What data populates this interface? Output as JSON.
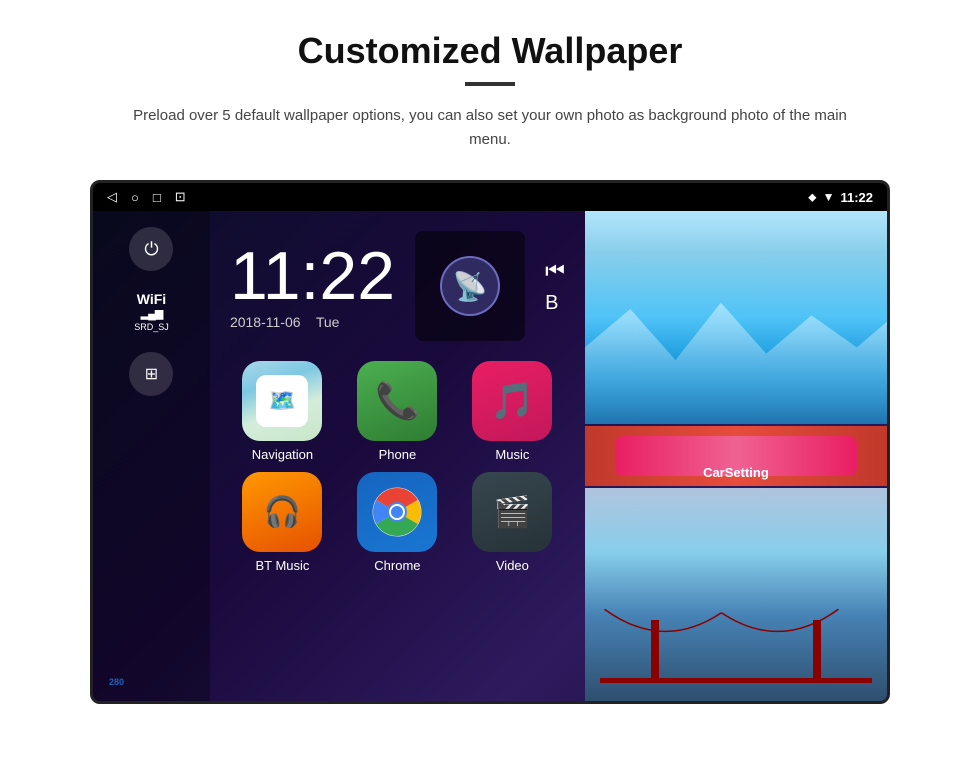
{
  "header": {
    "title": "Customized Wallpaper",
    "divider": true,
    "subtitle": "Preload over 5 default wallpaper options, you can also set your own photo as background photo of the main menu."
  },
  "device": {
    "status_bar": {
      "back_icon": "◁",
      "home_icon": "○",
      "recents_icon": "□",
      "screenshot_icon": "⊡",
      "location_icon": "⬥",
      "signal_icon": "▼",
      "time": "11:22"
    },
    "clock": {
      "time": "11:22",
      "date": "2018-11-06",
      "day": "Tue"
    },
    "sidebar": {
      "power_label": "⏻",
      "wifi_label": "WiFi",
      "wifi_bars": "▂▄▆",
      "wifi_name": "SRD_SJ",
      "apps_icon": "⊞"
    },
    "apps": [
      {
        "id": "navigation",
        "label": "Navigation",
        "icon_type": "navigation"
      },
      {
        "id": "phone",
        "label": "Phone",
        "icon_type": "phone"
      },
      {
        "id": "music",
        "label": "Music",
        "icon_type": "music"
      },
      {
        "id": "bt_music",
        "label": "BT Music",
        "icon_type": "bt_music"
      },
      {
        "id": "chrome",
        "label": "Chrome",
        "icon_type": "chrome"
      },
      {
        "id": "video",
        "label": "Video",
        "icon_type": "video"
      }
    ],
    "wallpapers": {
      "car_setting_label": "CarSetting"
    }
  }
}
